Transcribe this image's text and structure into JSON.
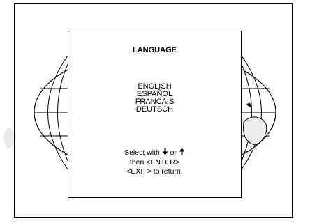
{
  "menu": {
    "title": "LANGUAGE",
    "languages": [
      "ENGLISH",
      "ESPAÑOL",
      "FRANCAIS",
      "DEUTSCH"
    ],
    "instructions": {
      "select_prefix": "Select with ",
      "or_text": " or ",
      "line2": "then <ENTER>",
      "line3": "<EXIT> to return."
    },
    "icons": [
      "arrow-down-icon",
      "arrow-up-icon"
    ]
  }
}
